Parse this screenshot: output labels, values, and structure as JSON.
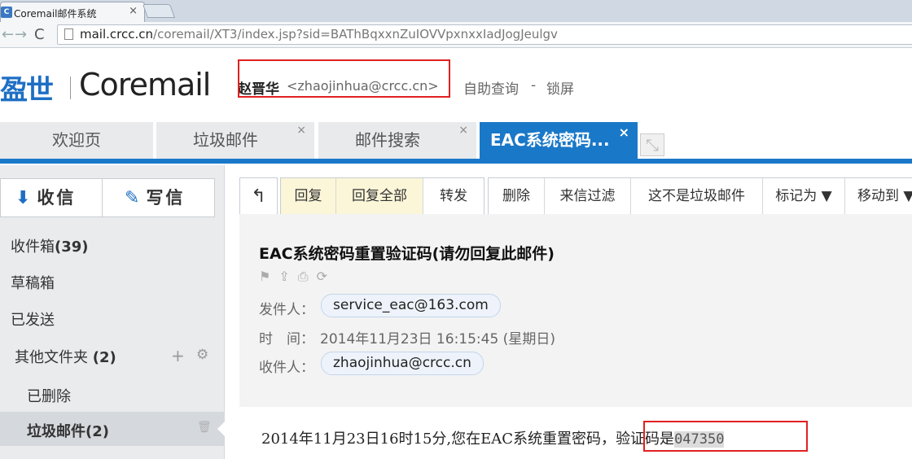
{
  "browser": {
    "tab_favicon": "C",
    "tab_title": "Coremail邮件系统",
    "tab_close": "×",
    "nav_back": "←",
    "nav_forward": "→",
    "nav_reload": "C",
    "url_host": "mail.crcc.cn",
    "url_path": "/coremail/XT3/index.jsp?sid=BAThBqxxnZuIOVVpxnxxIadJogJeulgv"
  },
  "header": {
    "logo_cn": "盈世",
    "logo_en": "Coremail",
    "user_name": "赵晋华",
    "user_email": "<zhaojinhua@crcc.cn>",
    "self_query": "自助查询",
    "separator": "-",
    "lock_screen": "锁屏",
    "highlight_color": "#e02020"
  },
  "tabs": [
    {
      "label": "欢迎页",
      "closable": false
    },
    {
      "label": "垃圾邮件",
      "closable": true,
      "close": "×"
    },
    {
      "label": "邮件搜索",
      "closable": true,
      "close": "×"
    },
    {
      "label": "EAC系统密码...",
      "closable": true,
      "close": "×",
      "active": true
    }
  ],
  "accent_color": "#1a78c8",
  "sidebar": {
    "receive_label": "收信",
    "write_label": "写信",
    "folders": {
      "inbox": "收件箱",
      "inbox_count": "(39)",
      "drafts": "草稿箱",
      "sent": "已发送",
      "other": "其他文件夹",
      "other_count": "(2)",
      "deleted": "已删除",
      "junk": "垃圾邮件",
      "junk_count": "(2)"
    },
    "add_icon": "+",
    "gear_icon": "⚙",
    "trash_icon": "🗑"
  },
  "actions": {
    "back": "↰",
    "reply": "回复",
    "reply_all": "回复全部",
    "forward": "转发",
    "delete": "删除",
    "filter": "来信过滤",
    "not_spam": "这不是垃圾邮件",
    "mark_as": "标记为 ▼",
    "move_to": "移动到 ▼"
  },
  "mail": {
    "subject": "EAC系统密码重置验证码(请勿回复此邮件)",
    "from_label": "发件人：",
    "from": "service_eac@163.com",
    "time_label": "时　间：",
    "time": "2014年11月23日 16:15:45 (星期日)",
    "to_label": "收件人：",
    "to": "zhaojinhua@crcc.cn",
    "body_prefix": "2014年11月23日16时15分,您在EAC系统重置密码，",
    "body_code_label": "验证码是",
    "body_code": "047350"
  }
}
